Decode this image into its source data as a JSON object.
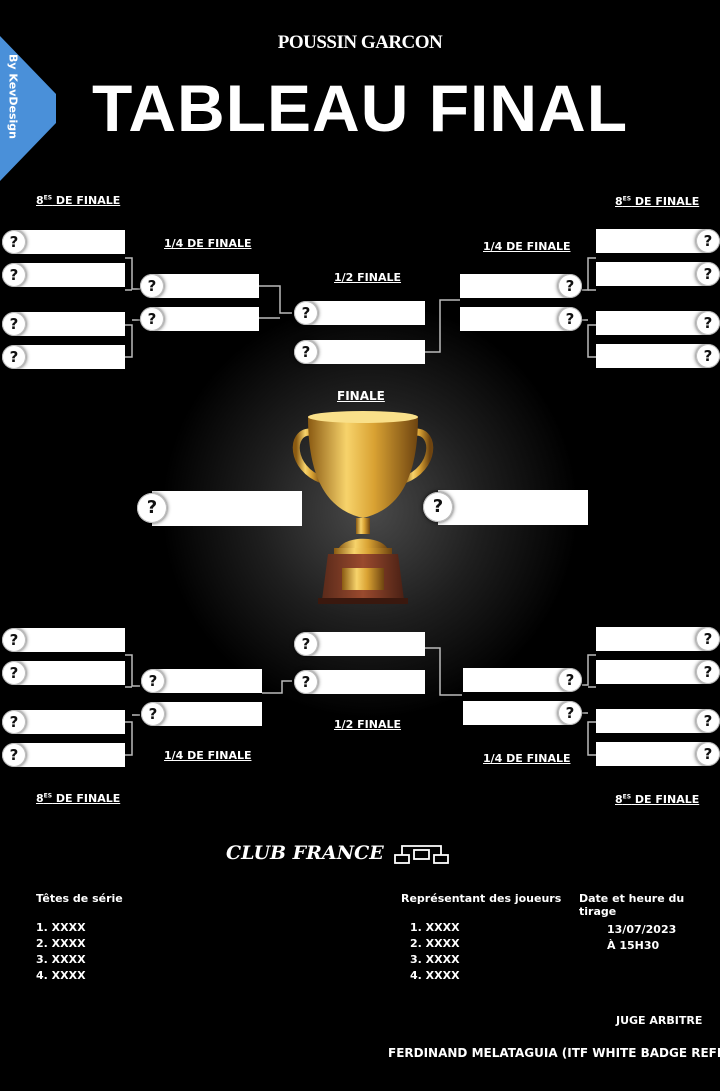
{
  "brand": "By KevDesign",
  "header": {
    "subtitle": "POUSSIN GARCON",
    "title": "TABLEAU FINAL"
  },
  "rounds": {
    "r16_pre": "8",
    "r16_sup": "ES",
    "r16_text": " DE FINALE",
    "quarter": "1/4 DE FINALE",
    "semi": "1/2 FINALE",
    "final": "FINALE"
  },
  "slot_mark": "?",
  "club": "CLUB FRANCE",
  "seeds": {
    "heading": "Têtes de série",
    "items": [
      "1. XXXX",
      "2. XXXX",
      "3. XXXX",
      "4. XXXX"
    ]
  },
  "reps": {
    "heading": "Représentant des joueurs",
    "items": [
      "1. XXXX",
      "2. XXXX",
      "3. XXXX",
      "4. XXXX"
    ]
  },
  "draw": {
    "heading": "Date et heure du tirage",
    "date": "13/07/2023",
    "time": "À 15H30"
  },
  "referee": {
    "label": "JUGE ARBITRE",
    "name": "FERDINAND MELATAGUIA (ITF WHITE BADGE REFEREE)"
  }
}
